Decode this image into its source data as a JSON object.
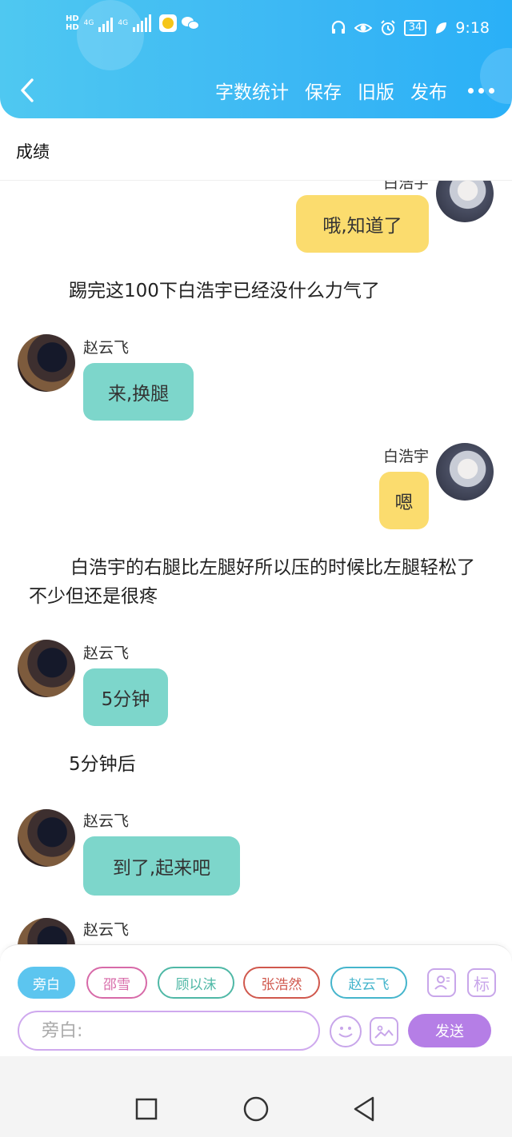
{
  "status_bar": {
    "time": "9:18",
    "battery": "34",
    "network_1": "4G",
    "network_2": "4G"
  },
  "nav": {
    "items": [
      "字数统计",
      "保存",
      "旧版",
      "发布"
    ]
  },
  "title": "成绩",
  "chat": {
    "partial_name_top": "白浩宇",
    "msg1": {
      "speaker": "",
      "text": "哦,知道了"
    },
    "narr1": "踢完这100下白浩宇已经没什么力气了",
    "msg2": {
      "speaker": "赵云飞",
      "text": "来,换腿"
    },
    "msg3": {
      "speaker": "白浩宇",
      "text": "嗯"
    },
    "narr2": "白浩宇的右腿比左腿好所以压的时候比左腿轻松了不少但还是很疼",
    "msg4": {
      "speaker": "赵云飞",
      "text": "5分钟"
    },
    "narr3": "5分钟后",
    "msg5": {
      "speaker": "赵云飞",
      "text": "到了,起来吧"
    },
    "msg6": {
      "speaker": "赵云飞"
    }
  },
  "roles": [
    {
      "label": "旁白",
      "color": "#5cc5ef",
      "active": true
    },
    {
      "label": "邵雪",
      "color": "#d76aa8",
      "active": false
    },
    {
      "label": "顾以沫",
      "color": "#4fb8a6",
      "active": false
    },
    {
      "label": "张浩然",
      "color": "#d0584d",
      "active": false
    },
    {
      "label": "赵云飞",
      "color": "#45b5cc",
      "active": false
    }
  ],
  "tools": {
    "mark_label": "标"
  },
  "input": {
    "placeholder": "旁白:"
  },
  "send_label": "发送",
  "colors": {
    "header": "#3bb7f4",
    "yellow_bubble": "#fbdc6e",
    "green_bubble": "#7dd6cb",
    "send": "#b57ee6"
  }
}
